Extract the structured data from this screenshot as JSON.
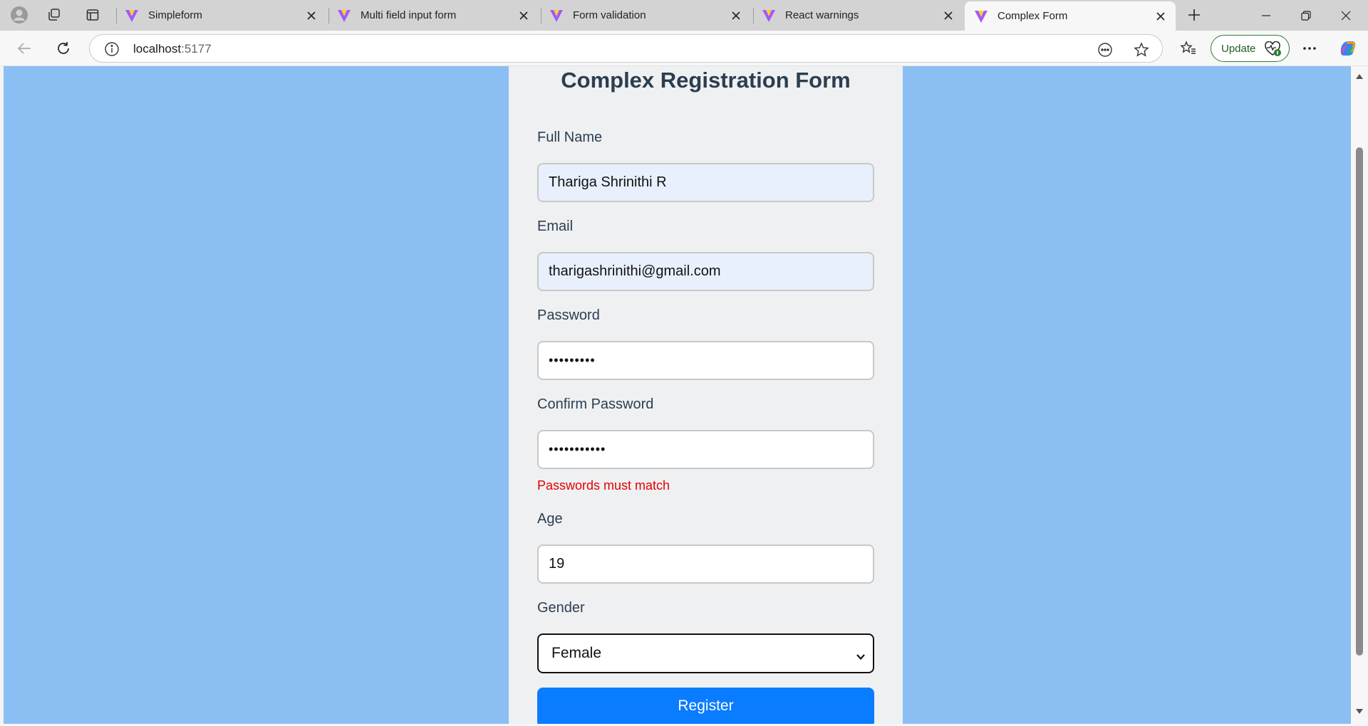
{
  "browser": {
    "tabs": [
      {
        "title": "Simpleform",
        "active": false
      },
      {
        "title": "Multi field input form",
        "active": false
      },
      {
        "title": "Form validation",
        "active": false
      },
      {
        "title": "React warnings",
        "active": false
      },
      {
        "title": "Complex Form",
        "active": true
      }
    ],
    "url_host": "localhost",
    "url_port": ":5177",
    "update_label": "Update",
    "icons": [
      "profile-icon",
      "workspaces-icon",
      "vertical-tabs-icon",
      "vite-logo-icon",
      "close-icon",
      "new-tab-icon",
      "minimize-icon",
      "restore-icon",
      "window-close-icon",
      "back-icon",
      "refresh-icon",
      "site-info-icon",
      "read-aloud-icon",
      "favorite-star-icon",
      "favorites-icon",
      "heartbeat-icon",
      "more-icon",
      "copilot-icon"
    ]
  },
  "form": {
    "title": "Complex Registration Form",
    "fields": {
      "full_name": {
        "label": "Full Name",
        "value": "Thariga Shrinithi R"
      },
      "email": {
        "label": "Email",
        "value": "tharigashrinithi@gmail.com"
      },
      "password": {
        "label": "Password",
        "value": "•••••••••"
      },
      "confirm_password": {
        "label": "Confirm Password",
        "value": "•••••••••••",
        "error": "Passwords must match"
      },
      "age": {
        "label": "Age",
        "value": "19"
      },
      "gender": {
        "label": "Gender",
        "value": "Female"
      }
    },
    "submit_label": "Register"
  },
  "colors": {
    "page_background": "#8bbff3",
    "card_background": "#eff0f2",
    "title_color": "#2c3e50",
    "error_color": "#e50000",
    "button_color": "#0a7cff",
    "autofill_background": "#e8f0fe"
  }
}
